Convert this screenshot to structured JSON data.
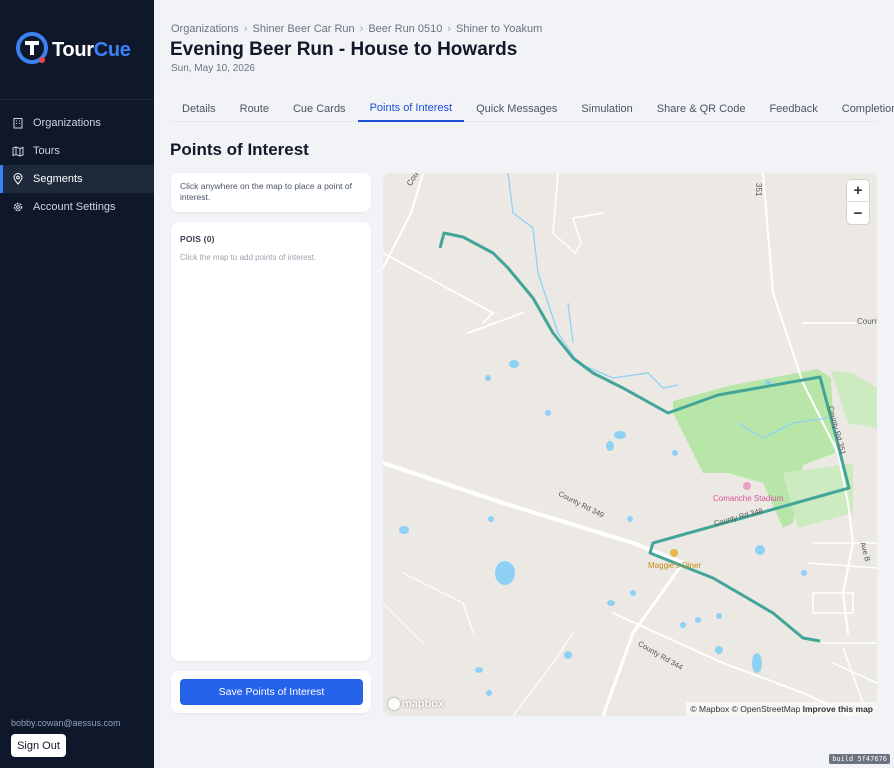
{
  "app": {
    "brand_part1": "Tour",
    "brand_part2": "Cue",
    "brand_color": "#3b82f6"
  },
  "sidebar": {
    "items": [
      {
        "label": "Organizations",
        "icon": "building-icon"
      },
      {
        "label": "Tours",
        "icon": "map-icon"
      },
      {
        "label": "Segments",
        "icon": "pin-icon",
        "active": true
      },
      {
        "label": "Account Settings",
        "icon": "gear-icon"
      }
    ],
    "user_email": "bobby.cowan@aessus.com",
    "signout_label": "Sign Out"
  },
  "breadcrumb": [
    "Organizations",
    "Shiner Beer Car Run",
    "Beer Run 0510",
    "Shiner to Yoakum"
  ],
  "header": {
    "title": "Evening Beer Run - House to Howards",
    "date": "Sun, May 10, 2026"
  },
  "tabs": [
    "Details",
    "Route",
    "Cue Cards",
    "Points of Interest",
    "Quick Messages",
    "Simulation",
    "Share & QR Code",
    "Feedback",
    "Completions"
  ],
  "active_tab": "Points of Interest",
  "main": {
    "section_title": "Points of Interest",
    "hint": "Click anywhere on the map to place a point of interest.",
    "pois_title": "POIS (0)",
    "pois_empty": "Click the map to add points of interest.",
    "save_label": "Save Points of Interest"
  },
  "map": {
    "zoom_in": "+",
    "zoom_out": "−",
    "logo_text": "mapbox",
    "attribution_1": "© Mapbox © OpenStreetMap",
    "attribution_2": "Improve this map",
    "labels": {
      "county_rd_top": "County Rd",
      "rd_351_top": "351",
      "county_right": "Count",
      "county_rd_351": "County Rd 351",
      "county_rd_349": "County Rd 349",
      "county_rd_348": "County Rd 348",
      "county_rd_344": "County Rd 344",
      "ave_b": "Ave B",
      "stadium": "Comanche Stadium",
      "diner": "Maggie's Diner"
    },
    "route_color": "#43a597",
    "park_color": "#b8e6a8",
    "water_color": "#8fd0f5"
  },
  "build": "build 5f47676"
}
